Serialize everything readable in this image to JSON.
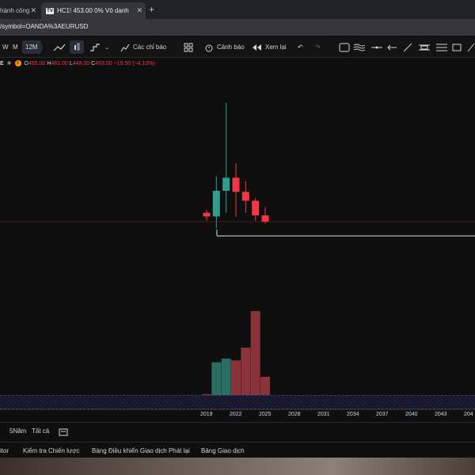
{
  "browser": {
    "tabs": [
      {
        "label": "hành công"
      },
      {
        "label": "HC1! 453.00 0% Vô danh"
      }
    ],
    "new_tab_glyph": "+",
    "close_glyph": "✕",
    "url": "/symbol=OANDA%3AEURUSD"
  },
  "toolbar": {
    "interval_w": "W",
    "interval_m": "M",
    "interval_12m": "12M",
    "indicators_label": "Các chỉ báo",
    "alert_label": "Cảnh báo",
    "replay_label": "Xem lại"
  },
  "legend": {
    "symbol_tail": "E",
    "badge": "D",
    "open_label": "O",
    "open": "465.00",
    "high_label": "H",
    "high": "481.00",
    "low_label": "L",
    "low": "449.00",
    "close_label": "C",
    "close": "453.00",
    "change": "−19.50 (−4.13%)"
  },
  "chart_data": {
    "type": "candlestick",
    "x": [
      2019,
      2020,
      2021,
      2022,
      2023,
      2024,
      2025
    ],
    "ohlc": [
      {
        "o": 470,
        "h": 476,
        "l": 455,
        "c": 463
      },
      {
        "o": 463,
        "h": 540,
        "l": 440,
        "c": 512
      },
      {
        "o": 512,
        "h": 680,
        "l": 470,
        "c": 537
      },
      {
        "o": 537,
        "h": 565,
        "l": 462,
        "c": 510
      },
      {
        "o": 510,
        "h": 530,
        "l": 470,
        "c": 493
      },
      {
        "o": 493,
        "h": 498,
        "l": 455,
        "c": 465
      },
      {
        "o": 465,
        "h": 481,
        "l": 449,
        "c": 453
      }
    ],
    "volume": [
      1,
      36,
      40,
      38,
      52,
      92,
      20
    ],
    "x_ticks": [
      "2019",
      "2022",
      "2025",
      "2028",
      "2031",
      "2034",
      "2037",
      "2040",
      "2043",
      "204"
    ],
    "colors": {
      "up": "#2f9e8f",
      "down": "#f23645",
      "vol_up": "#2b6d63",
      "vol_down": "#8a3339"
    }
  },
  "range": {
    "five_year": "5Năm",
    "all": "Tất cả"
  },
  "bottom_tabs": [
    "itor",
    "Kiểm tra Chiến lược",
    "Bảng Điều khiển Giao dịch Phát lại",
    "Bảng Giao dịch"
  ]
}
